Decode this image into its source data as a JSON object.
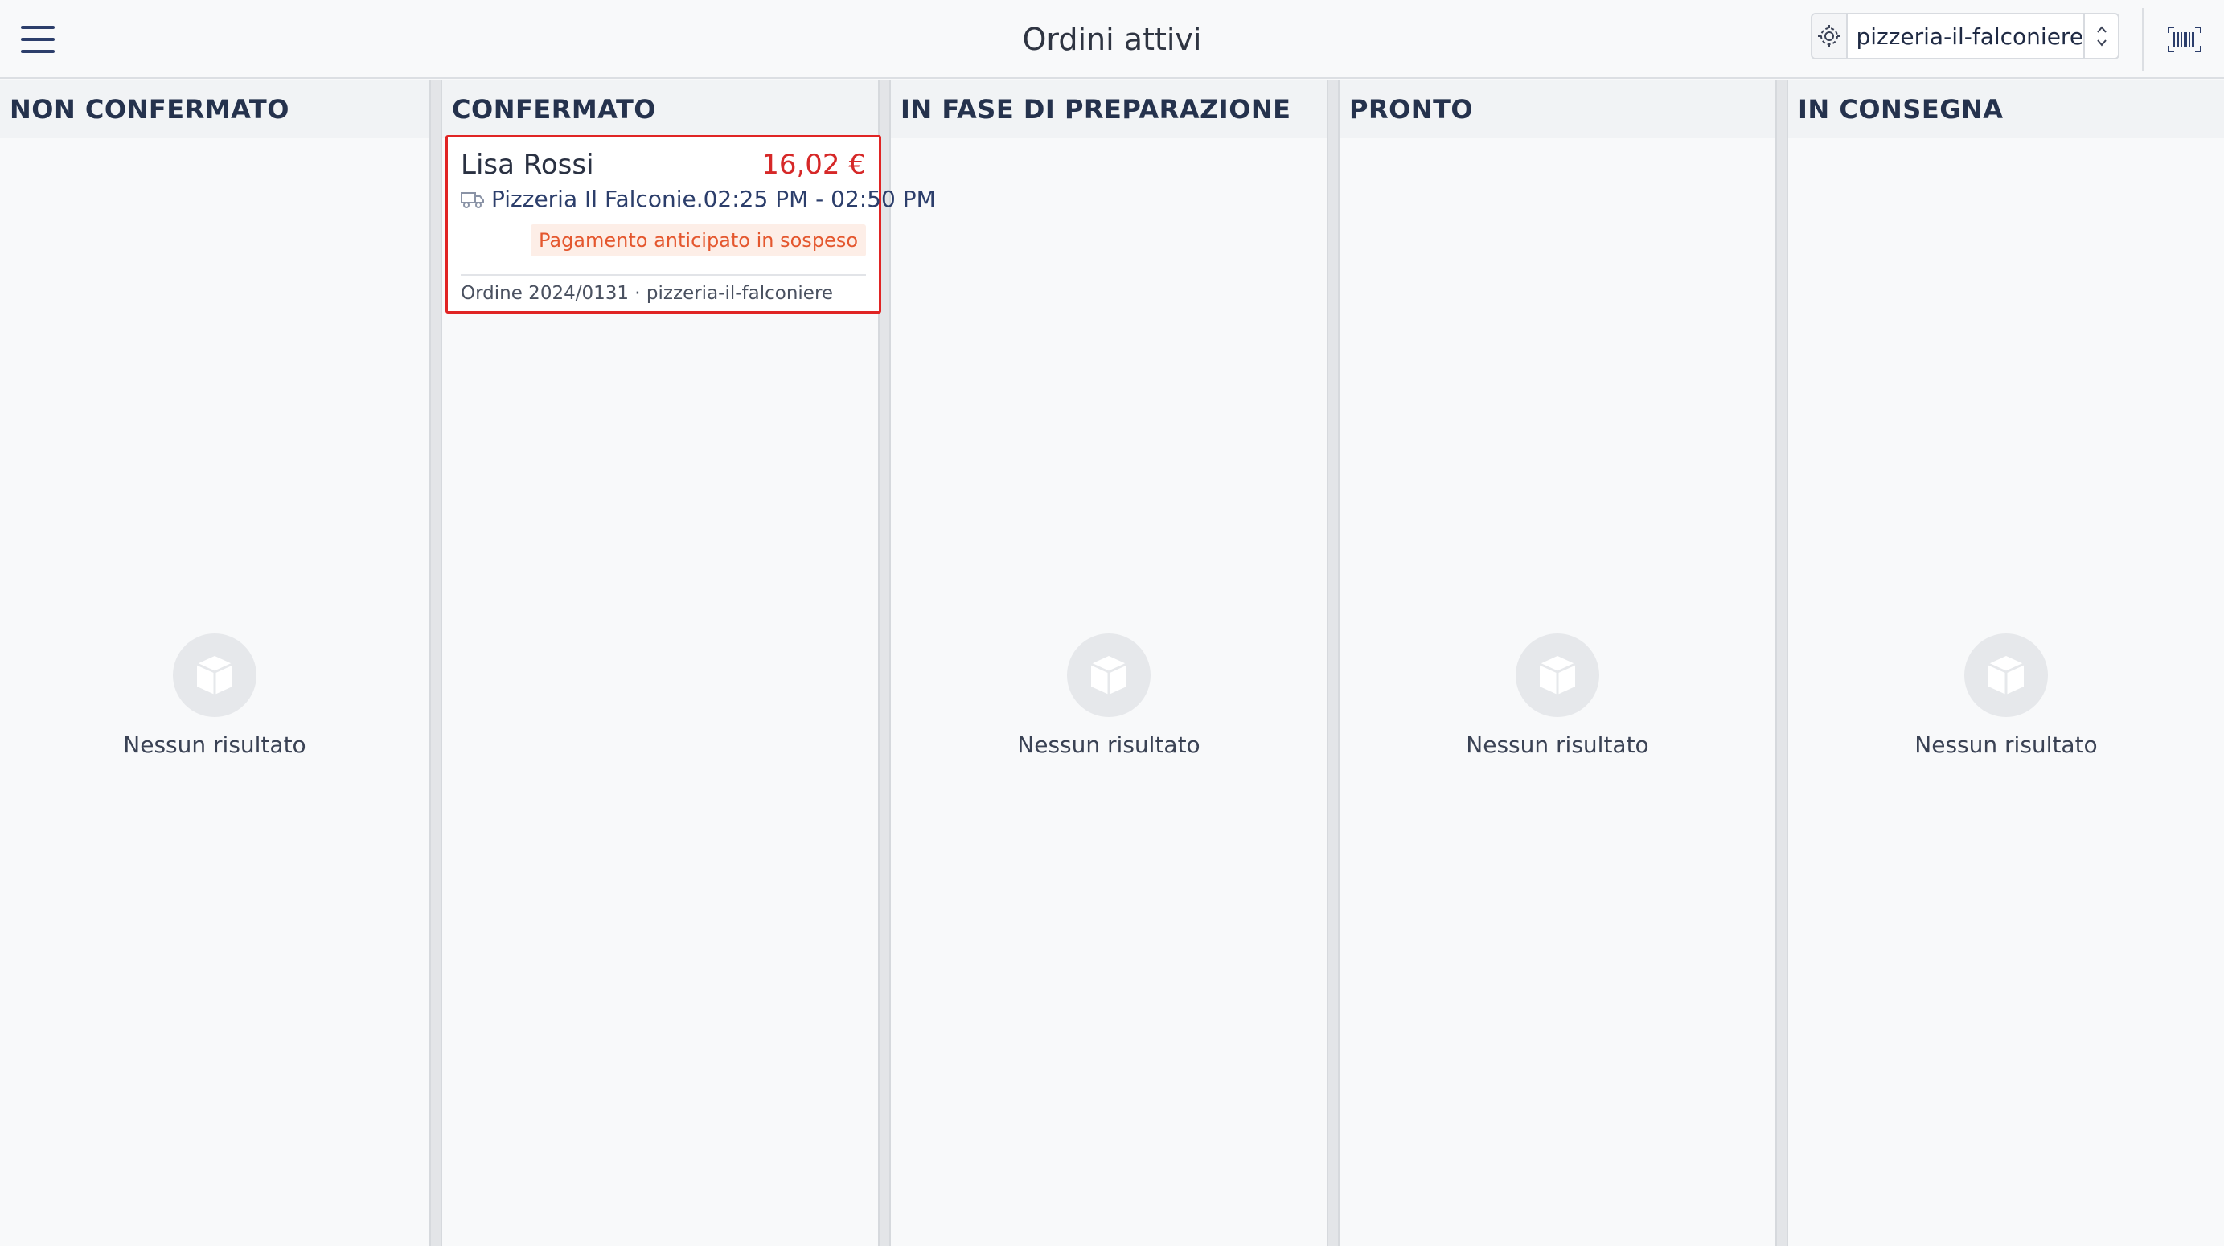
{
  "header": {
    "title": "Ordini attivi",
    "store_selector": {
      "value": "pizzeria-il-falconiere",
      "icon": "store-gear-icon"
    },
    "menu_icon": "hamburger-menu-icon",
    "barcode_icon": "barcode-scanner-icon"
  },
  "columns": [
    {
      "title": "NON CONFERMATO",
      "empty_text": "Nessun risultato"
    },
    {
      "title": "CONFERMATO",
      "empty_text": ""
    },
    {
      "title": "IN FASE DI PREPARAZIONE",
      "empty_text": "Nessun risultato"
    },
    {
      "title": "PRONTO",
      "empty_text": "Nessun risultato"
    },
    {
      "title": "IN CONSEGNA",
      "empty_text": "Nessun risultato"
    }
  ],
  "order_card": {
    "customer": "Lisa Rossi",
    "amount": "16,02 €",
    "store": "Pizzeria Il Falconie.",
    "time_window": "02:25 PM - 02:50 PM",
    "badge": "Pagamento anticipato in sospeso",
    "footer": "Ordine 2024/0131 · pizzeria-il-falconiere",
    "icon": "delivery-truck-icon"
  },
  "colors": {
    "accent_red": "#e02424",
    "badge_bg": "#fdeee7",
    "badge_text": "#e4572e",
    "primary_navy": "#2c3e6b"
  }
}
